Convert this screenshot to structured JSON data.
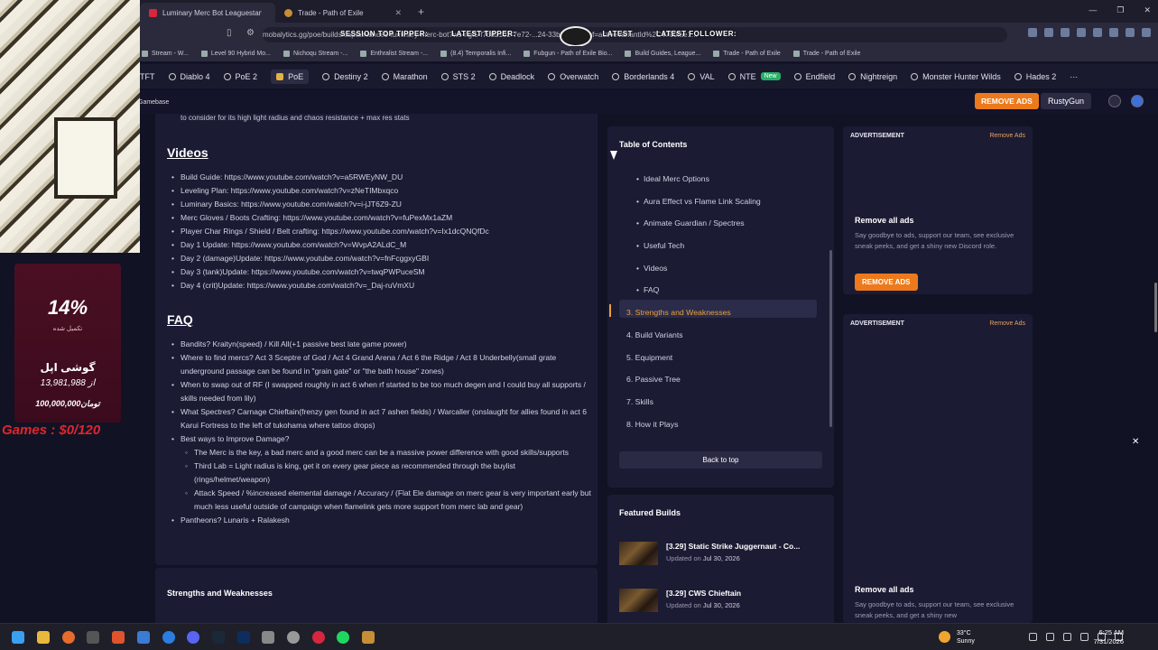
{
  "browser": {
    "tabs": [
      {
        "label": "Luminary Merc Bot Leaguestarter Bu",
        "active": true
      },
      {
        "label": "Trade - Path of Exile",
        "active": false
      }
    ],
    "new_tab": "+",
    "url": "mobalytics.gg/poe/builds/captainlance9-luminary-merc-bot?ws-ngf5-f7d82102-7e72-...24-33b67e8ae7bf=activeVariantId%2C4700fae1..."
  },
  "stream_overlay": {
    "session_top": "SESSION TOP TIPPER:",
    "latest_tipper": "LATEST TIPPER:",
    "latest": "LATEST",
    "latest_follower": "LATEST FOLLOWER:"
  },
  "bookmarks": [
    "Stream - W...",
    "Level 90 Hybrid Mo...",
    "Nichoqu Stream -...",
    "Enthralist Stream -...",
    "(8.4) Temporalis Infi...",
    "Fubgun - Path of Exile Bio...",
    "Build Guides, League...",
    "Trade - Path of Exile",
    "Trade - Path of Exile"
  ],
  "gamenav": {
    "items": [
      "TFT",
      "Diablo 4",
      "PoE 2",
      "PoE",
      "Destiny 2",
      "Marathon",
      "STS 2",
      "Deadlock",
      "Overwatch",
      "Borderlands 4",
      "VAL",
      "NTE",
      "Endfield",
      "Nightreign",
      "Monster Hunter Wilds",
      "Hades 2"
    ],
    "new_badge": "New",
    "more": "···"
  },
  "sitebar": {
    "logo": "Gamebase",
    "remove_ads": "REMOVE ADS",
    "user": "RustyGun"
  },
  "article": {
    "intro_tail": "to consider for its high light radius and chaos resistance + max res stats",
    "videos_heading": "Videos",
    "videos": [
      "Build Guide: https://www.youtube.com/watch?v=a5RWEyNW_DU",
      "Leveling Plan: https://www.youtube.com/watch?v=zNeTIMbxqco",
      "Luminary Basics: https://www.youtube.com/watch?v=i-jJT6Z9-ZU",
      "Merc Gloves / Boots Crafting: https://www.youtube.com/watch?v=fuPexMx1aZM",
      "Player Char Rings / Shield / Belt crafting: https://www.youtube.com/watch?v=Ix1dcQNQfDc",
      "Day 1 Update: https://www.youtube.com/watch?v=WvpA2ALdC_M",
      "Day 2 (damage)Update: https://www.youtube.com/watch?v=fnFcggxyGBI",
      "Day 3 (tank)Update: https://www.youtube.com/watch?v=twqPWPuceSM",
      "Day 4 (crit)Update: https://www.youtube.com/watch?v=_Daj-ruVmXU"
    ],
    "faq_heading": "FAQ",
    "faq": [
      {
        "t": "Bandits? Kraityn(speed) / Kill All(+1 passive best late game power)",
        "sub": false
      },
      {
        "t": "Where to find mercs? Act 3 Sceptre of God / Act 4 Grand Arena / Act 6 the Ridge / Act 8 Underbelly(small grate underground passage can be found in \"grain gate\" or \"the bath house\" zones)",
        "sub": false
      },
      {
        "t": "When to swap out of RF (I swapped roughly in act 6 when rf started to be too much degen and I could buy all supports / skills needed from lily)",
        "sub": false
      },
      {
        "t": "What Spectres? Carnage Chieftain(frenzy gen found in act 7 ashen fields) / Warcaller (onslaught for allies found in act 6 Karui Fortress to the left of tukohama where tattoo drops)",
        "sub": false
      },
      {
        "t": "Best ways to Improve Damage?",
        "sub": false
      },
      {
        "t": "The Merc is the key, a bad merc and a good merc can be a massive power difference with good skills/supports",
        "sub": true
      },
      {
        "t": "Third Lab = Light radius is king, get it on every gear piece as recommended through the buylist (rings/helmet/weapon)",
        "sub": true
      },
      {
        "t": "Attack Speed / %increased elemental damage / Accuracy / (Flat Ele damage on merc gear is very important early but much less useful outside of campaign when flamelink gets more support from merc lab and gear)",
        "sub": true
      },
      {
        "t": "Pantheons? Lunaris + Ralakesh",
        "sub": false
      }
    ],
    "sw_title": "Strengths and Weaknesses"
  },
  "toc": {
    "title": "Table of Contents",
    "sub_items": [
      "Ideal Merc Options",
      "Aura Effect vs Flame Link Scaling",
      "Animate Guardian / Spectres",
      "Useful Tech",
      "Videos",
      "FAQ"
    ],
    "active": "3. Strengths and Weaknesses",
    "items": [
      "4. Build Variants",
      "5. Equipment",
      "6. Passive Tree",
      "7. Skills",
      "8. How it Plays"
    ],
    "back_to_top": "Back to top"
  },
  "featured": {
    "title": "Featured Builds",
    "builds": [
      {
        "name": "[3.29] Static Strike Juggernaut - Co...",
        "updated_prefix": "Updated on",
        "date": "Jul 30, 2026"
      },
      {
        "name": "[3.29] CWS Chieftain",
        "updated_prefix": "Updated on",
        "date": "Jul 30, 2026"
      }
    ]
  },
  "ads": {
    "label": "ADVERTISEMENT",
    "remove_link": "Remove Ads",
    "title": "Remove all ads",
    "desc": "Say goodbye to ads, support our team, see exclusive sneak peeks, and get a shiny new Discord role.",
    "desc_cut": "Say goodbye to ads, support our team, see exclusive sneak peeks, and get a shiny new",
    "button": "REMOVE ADS"
  },
  "stream_goal": {
    "percent": "14%",
    "sub": "تکمیل شده",
    "item": "گوشی اپل",
    "amount": "13,981,988 از",
    "total": "100,000,000تومان",
    "games": "Games : $0/120"
  },
  "taskbar": {
    "weather_temp": "33°C",
    "weather_cond": "Sunny",
    "time": "6:25 AM",
    "date": "7/31/2026"
  },
  "colors": {
    "accent": "#ec7a1c",
    "bg": "#121225",
    "card": "#1b1b34",
    "toc_marker": "#e9a13b",
    "goal": "#e0262b"
  }
}
